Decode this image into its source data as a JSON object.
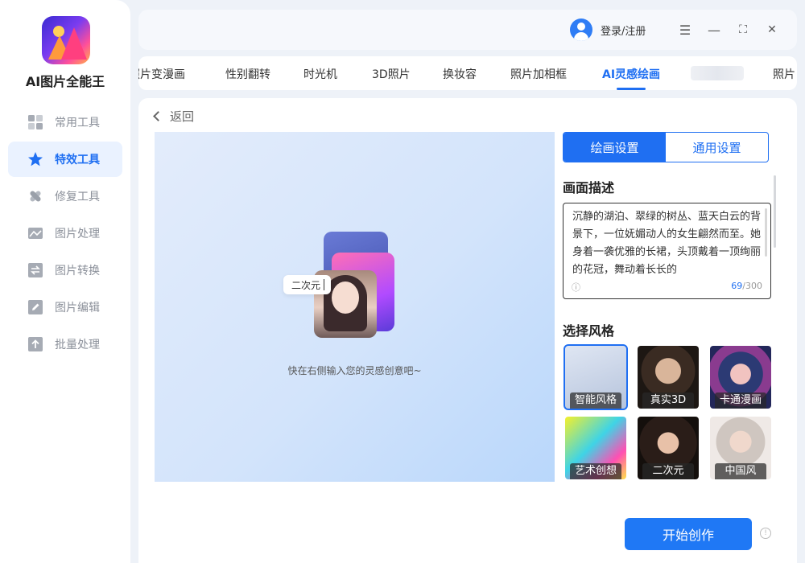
{
  "app": {
    "title": "AI图片全能王"
  },
  "sidebar": {
    "items": [
      {
        "label": "常用工具",
        "icon": "grid-icon",
        "active": false
      },
      {
        "label": "特效工具",
        "icon": "star-icon",
        "active": true
      },
      {
        "label": "修复工具",
        "icon": "bandage-icon",
        "active": false
      },
      {
        "label": "图片处理",
        "icon": "image-icon",
        "active": false
      },
      {
        "label": "图片转换",
        "icon": "convert-icon",
        "active": false
      },
      {
        "label": "图片编辑",
        "icon": "edit-icon",
        "active": false
      },
      {
        "label": "批量处理",
        "icon": "upload-icon",
        "active": false
      }
    ]
  },
  "titlebar": {
    "login": "登录/注册",
    "menu_icon": "☰",
    "minimize_icon": "—",
    "maximize_icon": "⛶",
    "close_icon": "✕"
  },
  "tabs": [
    {
      "label": "照片变漫画",
      "active": false
    },
    {
      "label": "性别翻转",
      "active": false
    },
    {
      "label": "时光机",
      "active": false
    },
    {
      "label": "3D照片",
      "active": false
    },
    {
      "label": "换妆容",
      "active": false
    },
    {
      "label": "照片加相框",
      "active": false
    },
    {
      "label": "AI灵感绘画",
      "active": true
    },
    {
      "label": "照片",
      "active": false
    }
  ],
  "main": {
    "back_label": "返回",
    "preview": {
      "chip_label": "二次元",
      "hint": "快在右侧输入您的灵感创意吧~"
    },
    "settings": {
      "tab_draw": "绘画设置",
      "tab_general": "通用设置",
      "desc_title": "画面描述",
      "desc_text": "沉静的湖泊、翠绿的树丛、蓝天白云的背景下，一位妩媚动人的女生翩然而至。她身着一袭优雅的长裙，头顶戴着一顶绚丽的花冠，舞动着长长的",
      "count_current": "69",
      "count_max": "/300",
      "style_title": "选择风格",
      "styles": [
        {
          "label": "智能风格",
          "selected": true
        },
        {
          "label": "真实3D",
          "selected": false
        },
        {
          "label": "卡通漫画",
          "selected": false
        },
        {
          "label": "艺术创想",
          "selected": false
        },
        {
          "label": "二次元",
          "selected": false
        },
        {
          "label": "中国风",
          "selected": false
        }
      ]
    },
    "start_button": "开始创作",
    "info_icon": "!"
  },
  "colors": {
    "accent": "#1f6ff2",
    "active_bg": "#eaf2ff"
  }
}
